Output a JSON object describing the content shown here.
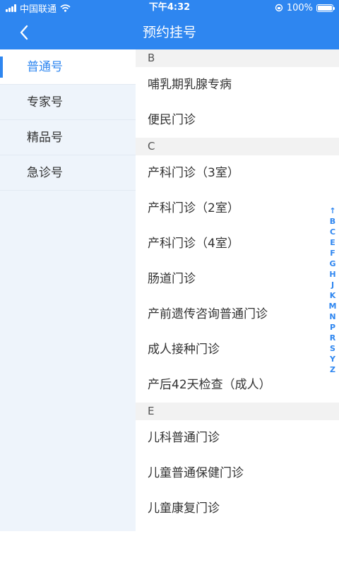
{
  "status_bar": {
    "carrier": "中国联通",
    "time": "下午4:32",
    "battery_percent_text": "100%",
    "battery_level": 1.0
  },
  "nav": {
    "title": "预约挂号"
  },
  "sidebar": {
    "items": [
      {
        "label": "普通号",
        "active": true
      },
      {
        "label": "专家号",
        "active": false
      },
      {
        "label": "精品号",
        "active": false
      },
      {
        "label": "急诊号",
        "active": false
      }
    ]
  },
  "sections": [
    {
      "letter": "B",
      "items": [
        "哺乳期乳腺专病",
        "便民门诊"
      ]
    },
    {
      "letter": "C",
      "items": [
        "产科门诊（3室）",
        "产科门诊（2室）",
        "产科门诊（4室）",
        "肠道门诊",
        "产前遗传咨询普通门诊",
        "成人接种门诊",
        "产后42天检查（成人）"
      ]
    },
    {
      "letter": "E",
      "items": [
        "儿科普通门诊",
        "儿童普通保健门诊",
        "儿童康复门诊"
      ]
    }
  ],
  "index_letters": [
    "↑",
    "B",
    "C",
    "E",
    "F",
    "G",
    "H",
    "J",
    "K",
    "M",
    "N",
    "P",
    "R",
    "S",
    "Y",
    "Z"
  ],
  "colors": {
    "accent": "#2e86f0",
    "sidebar_bg": "#eef4fb",
    "section_header_bg": "#f2f2f2"
  }
}
